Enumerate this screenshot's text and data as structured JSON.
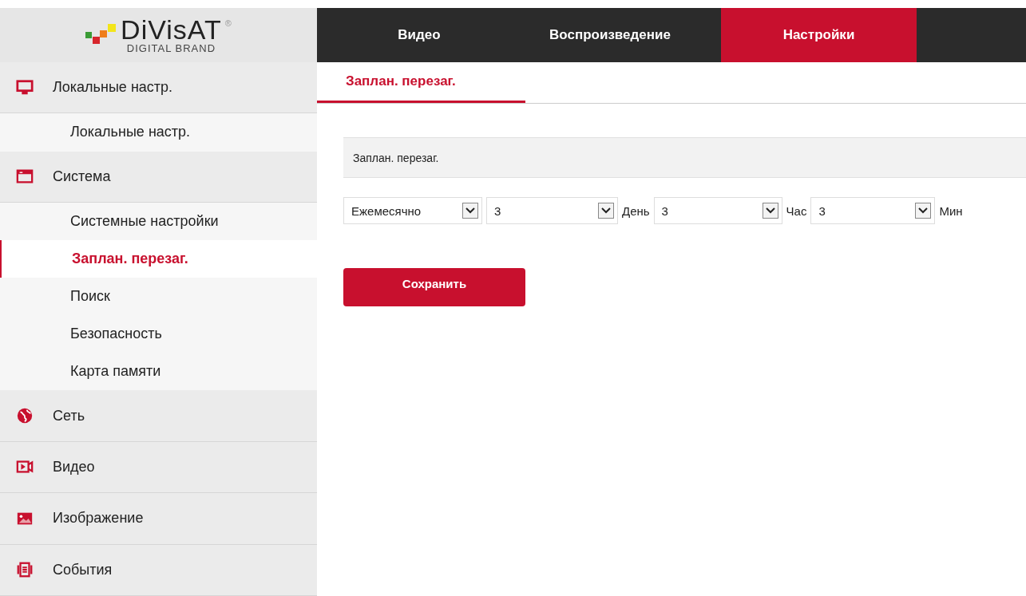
{
  "logo": {
    "brand": "DiVisAT",
    "registered": "®",
    "tagline": "DIGITAL BRAND"
  },
  "nav_tabs": [
    {
      "label": "Видео",
      "selected": false
    },
    {
      "label": "Воспроизведение",
      "selected": false
    },
    {
      "label": "Настройки",
      "selected": true
    }
  ],
  "sidebar": [
    {
      "label": "Локальные настр.",
      "children": [
        {
          "label": "Локальные настр.",
          "selected": false
        }
      ]
    },
    {
      "label": "Система",
      "children": [
        {
          "label": "Системные настройки",
          "selected": false
        },
        {
          "label": "Заплан. перезаг.",
          "selected": true
        },
        {
          "label": "Поиск",
          "selected": false
        },
        {
          "label": "Безопасность",
          "selected": false
        },
        {
          "label": "Карта памяти",
          "selected": false
        }
      ]
    },
    {
      "label": "Сеть"
    },
    {
      "label": "Видео"
    },
    {
      "label": "Изображение"
    },
    {
      "label": "События"
    }
  ],
  "content_tabs": [
    {
      "label": "Заплан. перезаг.",
      "selected": true
    }
  ],
  "section_title": "Заплан. перезаг.",
  "schedule": [
    {
      "kind": "select",
      "value": "Ежемесячно"
    },
    {
      "kind": "select",
      "value": "3"
    },
    {
      "kind": "label",
      "text": "День"
    },
    {
      "kind": "select",
      "value": "3"
    },
    {
      "kind": "label",
      "text": "Час"
    },
    {
      "kind": "select",
      "value": "3"
    },
    {
      "kind": "label",
      "text": "Мин"
    }
  ],
  "save_button": "Сохранить"
}
